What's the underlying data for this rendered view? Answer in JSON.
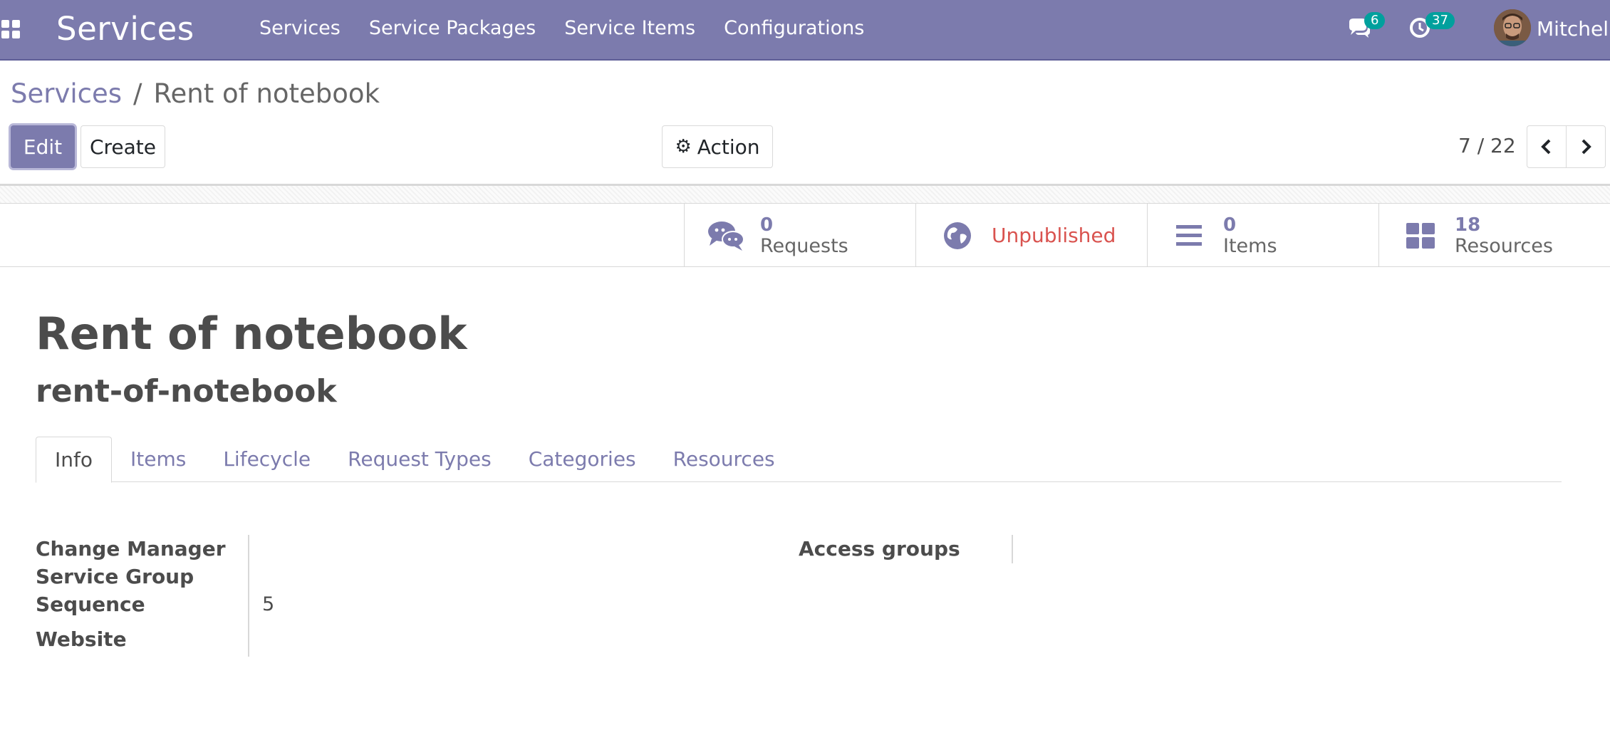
{
  "navbar": {
    "brand": "Services",
    "menu": [
      "Services",
      "Service Packages",
      "Service Items",
      "Configurations"
    ],
    "messages_count": "6",
    "activities_count": "37",
    "user_name": "Mitchell",
    "icons": {
      "apps": "apps-grid-icon",
      "messages": "chat-icon",
      "activities": "clock-icon"
    }
  },
  "breadcrumb": {
    "parent": "Services",
    "separator": "/",
    "current": "Rent of notebook"
  },
  "toolbar": {
    "edit_label": "Edit",
    "create_label": "Create",
    "action_label": "Action"
  },
  "pager": {
    "value": "7 / 22"
  },
  "stat_buttons": {
    "requests": {
      "value": "0",
      "label": "Requests"
    },
    "published": {
      "label": "Unpublished"
    },
    "items": {
      "value": "0",
      "label": "Items"
    },
    "resources": {
      "value": "18",
      "label": "Resources"
    }
  },
  "record": {
    "name": "Rent of notebook",
    "code": "rent-of-notebook"
  },
  "tabs": [
    "Info",
    "Items",
    "Lifecycle",
    "Request Types",
    "Categories",
    "Resources"
  ],
  "active_tab": "Info",
  "fields": {
    "change_manager": {
      "label": "Change Manager",
      "value": ""
    },
    "service_group": {
      "label": "Service Group",
      "value": ""
    },
    "sequence": {
      "label": "Sequence",
      "value": "5"
    },
    "website": {
      "label": "Website",
      "value": ""
    },
    "access_groups": {
      "label": "Access groups",
      "value": ""
    }
  },
  "colors": {
    "brand": "#7c7bad",
    "unpublished": "#d9534f",
    "badge": "#00a09d"
  }
}
